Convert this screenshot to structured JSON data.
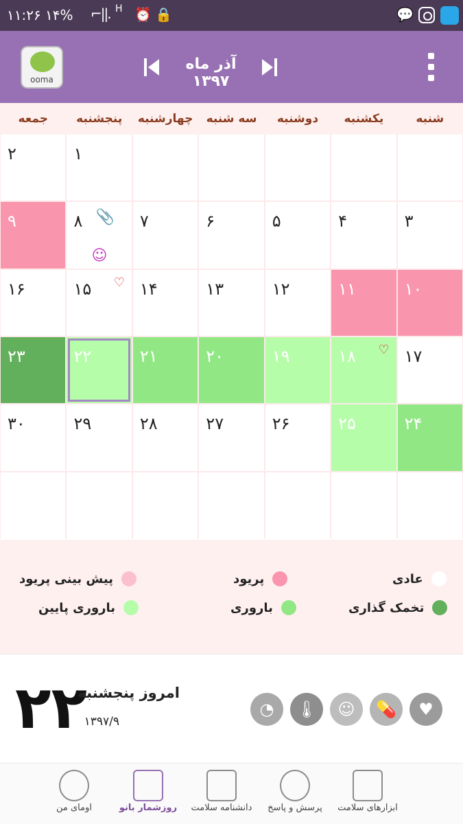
{
  "status_bar": {
    "time": "۱۱:۲۶",
    "battery": "۱۴%",
    "signal": "⌐||.",
    "network": "H"
  },
  "header": {
    "month_title": "آذر ماه ۱۳۹۷",
    "logo_text": "ooma"
  },
  "weekdays": [
    "شنبه",
    "یکشنبه",
    "دوشنبه",
    "سه شنبه",
    "چهارشنبه",
    "پنجشنبه",
    "جمعه"
  ],
  "calendar": {
    "rows": [
      [
        "",
        "",
        "",
        "",
        "",
        "۱",
        "۲"
      ],
      [
        "۳",
        "۴",
        "۵",
        "۶",
        "۷",
        "۸",
        "۹"
      ],
      [
        "۱۰",
        "۱۱",
        "۱۲",
        "۱۳",
        "۱۴",
        "۱۵",
        "۱۶"
      ],
      [
        "۱۷",
        "۱۸",
        "۱۹",
        "۲۰",
        "۲۱",
        "۲۲",
        "۲۳"
      ],
      [
        "۲۴",
        "۲۵",
        "۲۶",
        "۲۷",
        "۲۸",
        "۲۹",
        "۳۰"
      ],
      [
        "",
        "",
        "",
        "",
        "",
        "",
        ""
      ]
    ],
    "colors": {
      "period": "#f995ad",
      "fertile": "#92e785",
      "low_fertility": "#b6fdaa",
      "ovulation": "#62af5c"
    }
  },
  "legend": {
    "normal": "عادی",
    "period": "پریود",
    "predicted_period": "پیش بینی پریود",
    "ovulation": "تخمک گذاری",
    "fertile": "باروری",
    "low_fertility": "باروری پایین"
  },
  "today": {
    "day": "۲۲",
    "label": "امروز پنجشنبه",
    "date": "۱۳۹۷/۹"
  },
  "tools": [
    "heart-icon",
    "pill-icon",
    "mood-icon",
    "thermometer-icon",
    "scale-icon"
  ],
  "bottom_nav": [
    {
      "label": "ابزارهای سلامت"
    },
    {
      "label": "پرسش و پاسخ"
    },
    {
      "label": "دانشنامه سلامت"
    },
    {
      "label": "روزشمار بانو"
    },
    {
      "label": "اومای من"
    }
  ]
}
